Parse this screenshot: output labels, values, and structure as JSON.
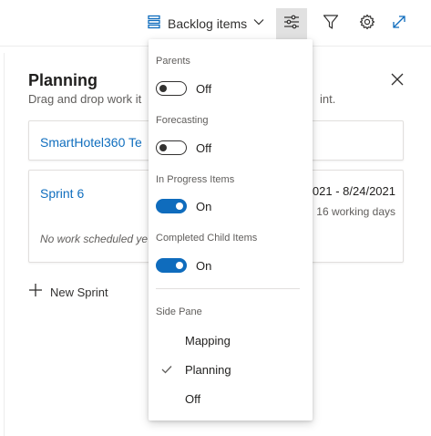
{
  "toolbar": {
    "backlog_label": "Backlog items",
    "icons": [
      "backlog-icon",
      "chevron-down-icon",
      "settings-sliders-icon",
      "filter-icon",
      "gear-icon",
      "expand-icon"
    ]
  },
  "planning": {
    "title": "Planning",
    "subtitle_start": "Drag and drop work it",
    "subtitle_end": "int.",
    "team": "SmartHotel360 Te",
    "sprint": {
      "name": "Sprint 6",
      "dates": "021 - 8/24/2021",
      "working_days": "16 working days",
      "empty_text": "No work scheduled ye"
    },
    "new_sprint_label": "New Sprint"
  },
  "menu": {
    "toggles": [
      {
        "label": "Parents",
        "state": "Off",
        "on": false
      },
      {
        "label": "Forecasting",
        "state": "Off",
        "on": false
      },
      {
        "label": "In Progress Items",
        "state": "On",
        "on": true
      },
      {
        "label": "Completed Child Items",
        "state": "On",
        "on": true
      }
    ],
    "side_pane": {
      "label": "Side Pane",
      "options": [
        {
          "label": "Mapping",
          "selected": false
        },
        {
          "label": "Planning",
          "selected": true
        },
        {
          "label": "Off",
          "selected": false
        }
      ]
    }
  },
  "colors": {
    "accent": "#0f6cbd",
    "link": "#106ebe",
    "active_button": "#e1e1e1"
  }
}
